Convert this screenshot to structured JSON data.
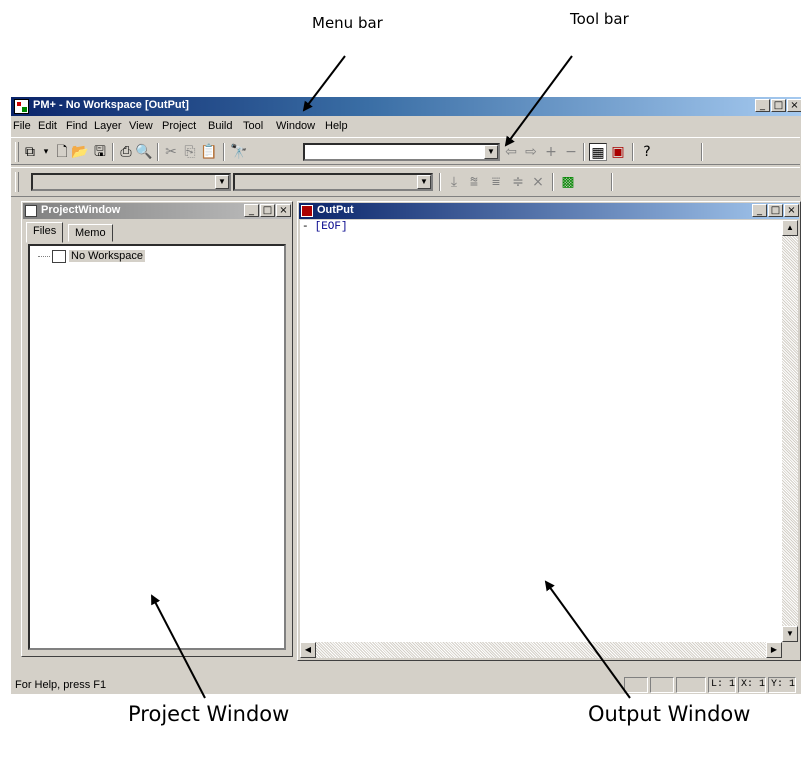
{
  "annotations": {
    "menu_bar": "Menu bar",
    "tool_bar": "Tool bar",
    "project_window": "Project Window",
    "output_window": "Output Window"
  },
  "app": {
    "title": "PM+ - No Workspace  [OutPut]",
    "buttons": [
      "_",
      "□",
      "×"
    ]
  },
  "menubar": {
    "items": [
      "File",
      "Edit",
      "Find",
      "Layer",
      "View",
      "Project",
      "Build",
      "Tool",
      "Window",
      "Help"
    ]
  },
  "toolbar": {
    "icons": [
      "open-project-icon",
      "dropdown-icon",
      "new-file-icon",
      "open-file-icon",
      "save-icon",
      "print-icon",
      "print-preview-icon",
      "cut-icon",
      "copy-icon",
      "paste-icon",
      "find-icon",
      "back-icon",
      "forward-icon",
      "add-icon",
      "remove-icon",
      "project-window-icon",
      "output-window-icon",
      "help-icon"
    ],
    "combo_value": ""
  },
  "toolbar2": {
    "combo1_value": "",
    "combo2_value": "",
    "icons": [
      "build-icon",
      "rebuild-icon",
      "build-all-icon",
      "stop-icon",
      "clean-icon",
      "debug-icon"
    ]
  },
  "project_window": {
    "title": "ProjectWindow",
    "tabs": [
      "Files",
      "Memo"
    ],
    "active_tab": "Files",
    "tree": [
      {
        "label": "No Workspace"
      }
    ]
  },
  "output_window": {
    "title": "OutPut",
    "lines": [
      {
        "marker": "-",
        "text": "[EOF]"
      }
    ]
  },
  "statusbar": {
    "text": "For Help, press F1",
    "line": "L: 1",
    "x": "X: 1",
    "y": "Y: 1"
  },
  "colors": {
    "titlebar_active": "#0a246a",
    "titlebar_inactive": "#808080",
    "face": "#d4d0c8",
    "eof_text": "#00008b"
  }
}
